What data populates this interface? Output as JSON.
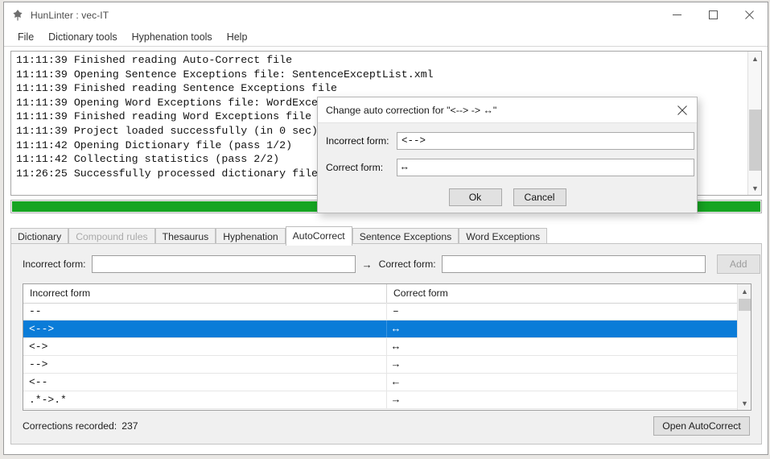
{
  "window": {
    "title": "HunLinter : vec-IT",
    "icon": "app-icon",
    "minimize_label": "—",
    "maximize_label": "□",
    "close_label": "✕"
  },
  "menubar": {
    "items": [
      {
        "label": "File"
      },
      {
        "label": "Dictionary tools"
      },
      {
        "label": "Hyphenation tools"
      },
      {
        "label": "Help"
      }
    ]
  },
  "log": {
    "lines": [
      "11:11:39 Finished reading Auto-Correct file",
      "11:11:39 Opening Sentence Exceptions file: SentenceExceptList.xml",
      "11:11:39 Finished reading Sentence Exceptions file",
      "11:11:39 Opening Word Exceptions file: WordExceptList.xml",
      "11:11:39 Finished reading Word Exceptions file",
      "11:11:39 Project loaded successfully (in 0 sec)",
      "11:11:42 Opening Dictionary file (pass 1/2)",
      "11:11:42 Collecting statistics (pass 2/2)",
      "11:26:25 Successfully processed dictionary file"
    ],
    "text": "11:11:39 Finished reading Auto-Correct file\n11:11:39 Opening Sentence Exceptions file: SentenceExceptList.xml\n11:11:39 Finished reading Sentence Exceptions file\n11:11:39 Opening Word Exceptions file: WordExceptList.xml\n11:11:39 Finished reading Word Exceptions file\n11:11:39 Project loaded successfully (in 0 sec)\n11:11:42 Opening Dictionary file (pass 1/2)\n11:11:42 Collecting statistics (pass 2/2)\n11:26:25 Successfully processed dictionary file"
  },
  "progress": {
    "percent": 100,
    "color": "#16a422"
  },
  "tabs": [
    {
      "label": "Dictionary",
      "state": "normal"
    },
    {
      "label": "Compound rules",
      "state": "disabled"
    },
    {
      "label": "Thesaurus",
      "state": "normal"
    },
    {
      "label": "Hyphenation",
      "state": "normal"
    },
    {
      "label": "AutoCorrect",
      "state": "active"
    },
    {
      "label": "Sentence Exceptions",
      "state": "normal"
    },
    {
      "label": "Word Exceptions",
      "state": "normal"
    }
  ],
  "autocorrect": {
    "incorrect_label": "Incorrect form:",
    "incorrect_value": "",
    "incorrect_placeholder": "",
    "arrow": "→",
    "correct_label": "Correct form:",
    "correct_value": "",
    "correct_placeholder": "",
    "add_label": "Add",
    "add_enabled": false,
    "columns": [
      "Incorrect form",
      "Correct form"
    ],
    "rows": [
      {
        "incorrect": "--",
        "correct": "–",
        "selected": false
      },
      {
        "incorrect": "<-->",
        "correct": "↔",
        "selected": true
      },
      {
        "incorrect": "<->",
        "correct": "↔",
        "selected": false
      },
      {
        "incorrect": "-->",
        "correct": "→",
        "selected": false
      },
      {
        "incorrect": "<--",
        "correct": "←",
        "selected": false
      },
      {
        "incorrect": ".*->.*",
        "correct": "→",
        "selected": false
      }
    ],
    "status_label": "Corrections recorded:",
    "status_count": "237",
    "open_button": "Open AutoCorrect",
    "selection_color": "#0a7cd8"
  },
  "dialog": {
    "title": "Change auto correction for \"<--> -> ↔\"",
    "close_label": "✕",
    "incorrect_label": "Incorrect form:",
    "incorrect_value": "<-->",
    "correct_label": "Correct form:",
    "correct_value": "↔",
    "ok_label": "Ok",
    "cancel_label": "Cancel"
  }
}
